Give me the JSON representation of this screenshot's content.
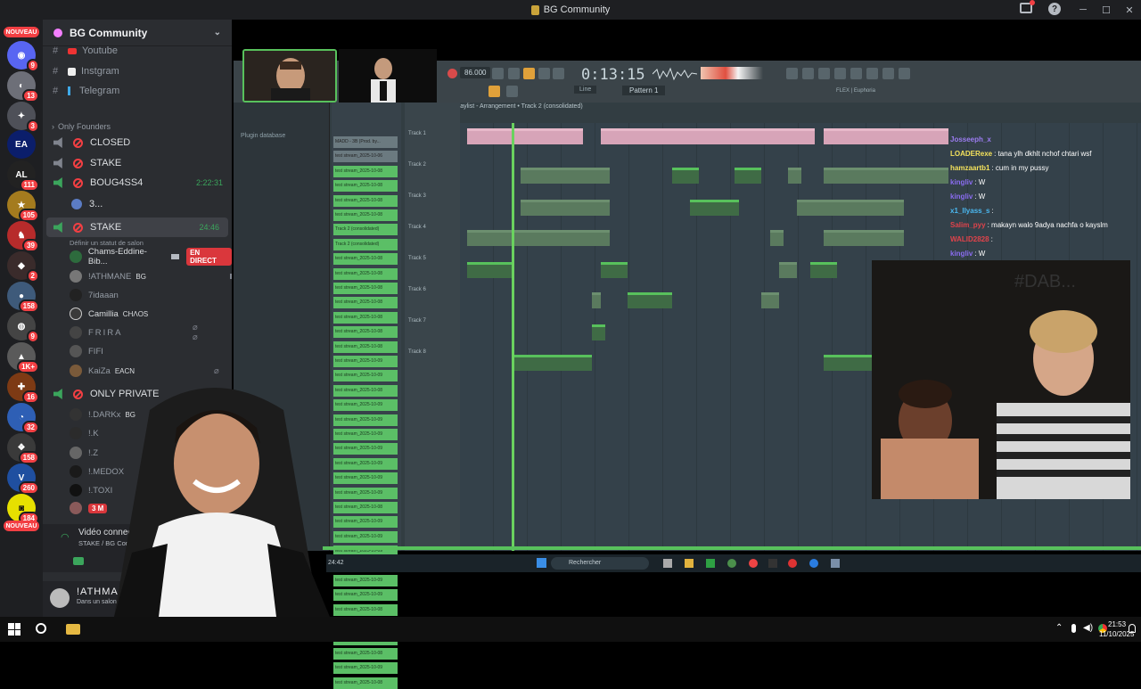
{
  "window": {
    "title": "BG Community"
  },
  "server_rail": {
    "new_label": "NOUVEAU",
    "badges": [
      "9",
      "13",
      "3",
      "111",
      "105",
      "39",
      "2",
      "158",
      "9",
      "1K+",
      "16",
      "32",
      "158",
      "260",
      "184"
    ],
    "bottom_label": "NOUVEAU"
  },
  "guild": {
    "name": "BG Community",
    "text_channels": [
      "Youtube",
      "Instgram",
      "Telegram"
    ],
    "category": "Only Founders",
    "voice_channels": [
      {
        "name": "CLOSED"
      },
      {
        "name": "STAKE"
      },
      {
        "name": "BOUG4SS4",
        "time": "2:22:31"
      },
      {
        "name": "3..."
      },
      {
        "name": "STAKE",
        "time": "24:46",
        "status": "Définir un statut de salon"
      }
    ],
    "stake_users": [
      {
        "name": "Chams-Eddine-Bib...",
        "live": "EN DIRECT"
      },
      {
        "name": "!ATHMANE",
        "tag": "BG"
      },
      {
        "name": "7idaaan"
      },
      {
        "name": "Camillia",
        "tag": "CHɅOS"
      },
      {
        "name": "FRIRA"
      },
      {
        "name": "FIFI"
      },
      {
        "name": "KaiZa",
        "tag": "EACN"
      }
    ],
    "private_channel": "ONLY PRIVATE",
    "private_users": [
      {
        "name": "!.DARKx",
        "tag": "BG"
      },
      {
        "name": "!.K"
      },
      {
        "name": "!.Z"
      },
      {
        "name": "!.MEDOX"
      },
      {
        "name": "!.TOXI"
      },
      {
        "name": "3 M"
      }
    ]
  },
  "voice_status": {
    "title": "Vidéo connectée",
    "subtitle": "STAKE / BG Commu"
  },
  "user_panel": {
    "name": "!ATHMANE",
    "status": "Dans un salon voc"
  },
  "fl": {
    "bpm": "86.000",
    "time": "0:13:15",
    "pattern": "Pattern 1",
    "mode": "Line",
    "plugin_label": "FLEX | Euphoria",
    "playlist_title": "Playlist - Arrangement • Track 2 (consolidated)",
    "plugin_db": "Plugin database",
    "patterns": [
      "MADD - 3B (Prod. by...",
      "test stream_2025-10-06",
      "test stream_2025-10-08",
      "test stream_2025-10-08",
      "test stream_2025-10-08",
      "test stream_2025-10-08",
      "Track 2 (consolidated)",
      "Track 2 (consolidated)",
      "test stream_2025-10-08",
      "test stream_2025-10-08",
      "test stream_2025-10-08",
      "test stream_2025-10-08",
      "test stream_2025-10-08",
      "test stream_2025-10-08",
      "test stream_2025-10-08",
      "test stream_2025-10-09",
      "test stream_2025-10-09",
      "test stream_2025-10-08",
      "test stream_2025-10-09",
      "test stream_2025-10-09",
      "test stream_2025-10-09",
      "test stream_2025-10-09",
      "test stream_2025-10-09",
      "test stream_2025-10-09",
      "test stream_2025-10-09",
      "test stream_2025-10-08",
      "test stream_2025-10-09",
      "test stream_2025-10-09",
      "test stream_2025-10-09",
      "test stream_2025-10-09",
      "test stream_2025-10-09",
      "test stream_2025-10-09",
      "test stream_2025-10-08",
      "test stream_2025-10-09",
      "test stream_2025-10-09",
      "test stream_2025-10-08",
      "test stream_2025-10-09",
      "test stream_2025-10-08"
    ],
    "tracks": [
      "Track 1",
      "Track 2",
      "Track 3",
      "Track 4",
      "Track 5",
      "Track 6",
      "Track 7",
      "Track 8"
    ],
    "windows_taskbar": {
      "search": "Rechercher",
      "time_left": "24:42"
    }
  },
  "chat": [
    {
      "user": "Josseeph_x",
      "msg": "",
      "color": "#9b7cf0"
    },
    {
      "user": "LOADERexe",
      "msg": ": tana ylh dkhlt nchof chtari wsf",
      "color": "#f4e25c"
    },
    {
      "user": "hamzaartb1",
      "msg": ": cum in my pussy",
      "color": "#f4e25c"
    },
    {
      "user": "kingliv",
      "msg": ": W",
      "color": "#8a6cf0"
    },
    {
      "user": "kingliv",
      "msg": ": W",
      "color": "#8a6cf0"
    },
    {
      "user": "x1_llyass_s",
      "msg": ":",
      "color": "#4ab8f0"
    },
    {
      "user": "Salim_pyy",
      "msg": ": makayn walo 9adya nachfa o kayslm",
      "color": "#e0434b"
    },
    {
      "user": "WALID2828",
      "msg": ":",
      "color": "#e0434b"
    },
    {
      "user": "kingliv",
      "msg": ": W",
      "color": "#8a6cf0"
    }
  ],
  "taskbar": {
    "time": "21:53",
    "date": "11/10/2025"
  }
}
